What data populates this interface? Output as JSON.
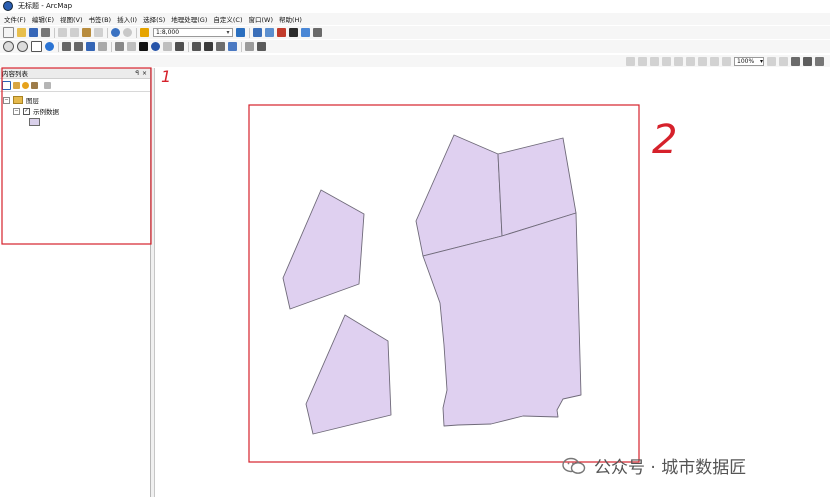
{
  "window": {
    "title": "无标题 - ArcMap"
  },
  "menubar": {
    "items": [
      "文件(F)",
      "编辑(E)",
      "视图(V)",
      "书签(B)",
      "插入(I)",
      "选择(S)",
      "地理处理(G)",
      "自定义(C)",
      "窗口(W)",
      "帮助(H)"
    ]
  },
  "toolbar": {
    "scale_value": "1:8,000",
    "zoom_value": "100%"
  },
  "toc": {
    "title": "内容列表",
    "pin": "ꟼ",
    "close": "×",
    "root_label": "图层",
    "layer_label": "示例数据"
  },
  "annotations": {
    "label_1": "1",
    "label_2": "2"
  },
  "watermark": {
    "text": "公众号 · 城市数据匠"
  },
  "colors": {
    "polygon_fill": "#dfd0f0",
    "polygon_stroke": "#6f6a79",
    "annotation_red": "#d6212b"
  },
  "icons": [
    "app-globe-icon",
    "new-icon",
    "open-icon",
    "save-icon",
    "print-icon",
    "cut-icon",
    "copy-icon",
    "paste-icon",
    "delete-icon",
    "undo-icon",
    "redo-icon",
    "add-data-icon",
    "zoom-in-icon",
    "zoom-out-icon",
    "pan-icon",
    "full-extent-icon",
    "select-icon",
    "identify-icon",
    "find-icon",
    "measure-icon",
    "html-popup-icon"
  ]
}
